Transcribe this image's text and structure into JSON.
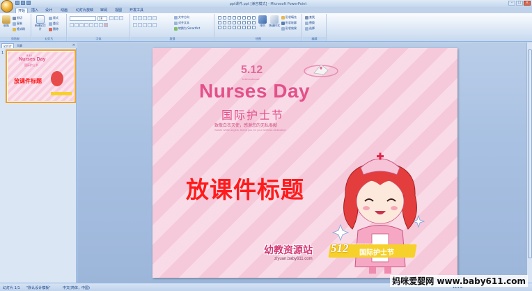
{
  "window": {
    "title": "ppt课件.ppt [兼容模式] - Microsoft PowerPoint",
    "minimize": "–",
    "maximize": "□",
    "close": "×"
  },
  "tabs": [
    "开始",
    "插入",
    "设计",
    "动画",
    "幻灯片放映",
    "审阅",
    "视图",
    "开发工具"
  ],
  "ribbon": {
    "clipboard": {
      "label": "剪贴板",
      "paste": "粘贴",
      "cut": "剪切",
      "copy": "复制",
      "format_painter": "格式刷"
    },
    "slides": {
      "label": "幻灯片",
      "new_slide": "新建幻灯片",
      "layout": "版式",
      "reset": "重设",
      "delete": "删除"
    },
    "font": {
      "label": "字体",
      "font_size": "18"
    },
    "paragraph": {
      "label": "段落",
      "text_direction": "文字方向",
      "align_text": "对齐文本",
      "smartart": "转换为 SmartArt"
    },
    "drawing": {
      "label": "绘图",
      "arrange": "排列",
      "quick_styles": "快速样式",
      "shape_fill": "形状填充",
      "shape_outline": "形状轮廓",
      "shape_effects": "形状效果"
    },
    "editing": {
      "label": "编辑",
      "find": "查找",
      "replace": "替换",
      "select": "选择"
    }
  },
  "left_panel": {
    "tab_slides": "幻灯片",
    "tab_outline": "大纲",
    "close": "×",
    "slide_number": "1"
  },
  "slide": {
    "year_tag": "5.12",
    "international": "International",
    "heading": "Nurses Day",
    "heading_cn": "国际护士节",
    "slogan": "致敬白衣天使，感谢您的无私奉献",
    "slogan_en": "Salute white angels, thank you for your selfless dedication",
    "title": "放课件标题",
    "banner_num": "512",
    "banner_small": "International Nurses' Day",
    "banner_cn": "国际护士节",
    "logo": "幼教资源站",
    "logo_url": "ziyuan.baby611.com"
  },
  "status": {
    "slide_info": "幻灯片 1/1",
    "theme": "\"默认设计模板\"",
    "language": "中文(简体，中国)",
    "zoom": "115%"
  },
  "watermark": "妈咪爱婴网 www.baby611.com"
}
